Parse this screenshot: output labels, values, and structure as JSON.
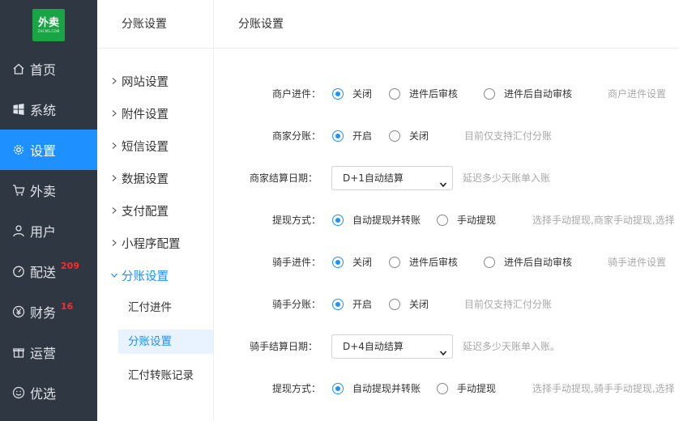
{
  "logo": {
    "text": "外卖",
    "subtext": "ZHCMS.COM"
  },
  "nav": [
    {
      "label": "首页",
      "icon": "home-icon"
    },
    {
      "label": "系统",
      "icon": "windows-icon"
    },
    {
      "label": "设置",
      "icon": "gear-icon",
      "active": true
    },
    {
      "label": "外卖",
      "icon": "cart-icon"
    },
    {
      "label": "用户",
      "icon": "user-icon"
    },
    {
      "label": "配送",
      "icon": "gauge-icon",
      "badge": "209"
    },
    {
      "label": "财务",
      "icon": "yen-icon",
      "badge": "16"
    },
    {
      "label": "运营",
      "icon": "gift-icon"
    },
    {
      "label": "优选",
      "icon": "smile-icon"
    }
  ],
  "subnav": {
    "title": "分账设置",
    "items": [
      "网站设置",
      "附件设置",
      "短信设置",
      "数据设置",
      "支付配置",
      "小程序配置",
      "分账设置"
    ],
    "children": [
      "汇付进件",
      "分账设置",
      "汇付转账记录"
    ]
  },
  "main": {
    "title": "分账设置",
    "rows": {
      "merchant_entry": {
        "label": "商户进件：",
        "opt1": "关闭",
        "opt2": "进件后审核",
        "opt3": "进件后自动审核",
        "hint": "商户进件设置"
      },
      "merchant_split": {
        "label": "商家分账：",
        "opt1": "开启",
        "opt2": "关闭",
        "hint": "目前仅支持汇付分账"
      },
      "merchant_settle": {
        "label": "商家结算日期：",
        "value": "D+1自动结算",
        "hint": "延迟多少天账单入账"
      },
      "merchant_withdraw": {
        "label": "提现方式：",
        "opt1": "自动提现并转账",
        "opt2": "手动提现",
        "hint": "选择手动提现,商家手动提现,选择"
      },
      "rider_entry": {
        "label": "骑手进件：",
        "opt1": "关闭",
        "opt2": "进件后审核",
        "opt3": "进件后自动审核",
        "hint": "骑手进件设置"
      },
      "rider_split": {
        "label": "骑手分账：",
        "opt1": "开启",
        "opt2": "关闭",
        "hint": "目前仅支持汇付分账"
      },
      "rider_settle": {
        "label": "骑手结算日期：",
        "value": "D+4自动结算",
        "hint": "延迟多少天账单入账。"
      },
      "rider_withdraw": {
        "label": "提现方式：",
        "opt1": "自动提现并转账",
        "opt2": "手动提现",
        "hint": "选择手动提现,骑手手动提现,选择"
      }
    }
  },
  "colors": {
    "nav_bg": "#2f3742",
    "accent": "#1e90ff",
    "logo_green": "#19a544",
    "badge": "#ff2a2a"
  }
}
